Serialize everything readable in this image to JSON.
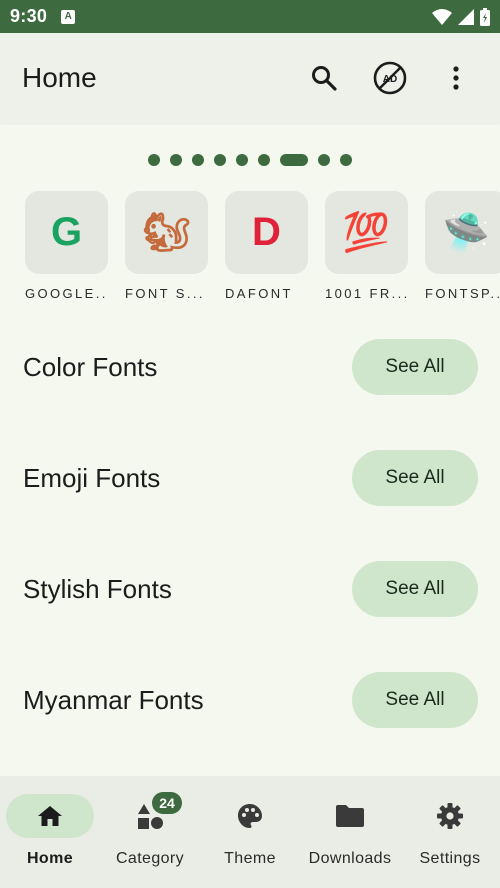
{
  "status_bar": {
    "time": "9:30",
    "a_icon_letter": "A"
  },
  "app_bar": {
    "title": "Home"
  },
  "pager": {
    "count": 9,
    "active_index": 6
  },
  "sources": [
    {
      "label": "GOOGLE...",
      "icon": "google-g-icon",
      "glyph": "G",
      "color": "#1aa260"
    },
    {
      "label": "FONT S...",
      "icon": "squirrel-icon",
      "glyph": "🐿",
      "color": "#c46a3c"
    },
    {
      "label": "DAFONT",
      "icon": "dafont-d-icon",
      "glyph": "D",
      "color": "#e0213a"
    },
    {
      "label": "1001 FR...",
      "icon": "hundred-icon",
      "glyph": "💯",
      "color": "#8a4fd1"
    },
    {
      "label": "FONTSP...",
      "icon": "ufo-icon",
      "glyph": "🛸",
      "color": "#5aa2c9"
    }
  ],
  "sections": [
    {
      "title": "Color Fonts",
      "button": "See All"
    },
    {
      "title": "Emoji Fonts",
      "button": "See All"
    },
    {
      "title": "Stylish Fonts",
      "button": "See All"
    },
    {
      "title": "Myanmar Fonts",
      "button": "See All"
    }
  ],
  "bottom_nav": {
    "home": "Home",
    "category": "Category",
    "category_badge": "24",
    "theme": "Theme",
    "downloads": "Downloads",
    "settings": "Settings"
  },
  "colors": {
    "primary": "#3d6b3f",
    "container": "#cfe6cc",
    "background": "#f4f8ef"
  }
}
